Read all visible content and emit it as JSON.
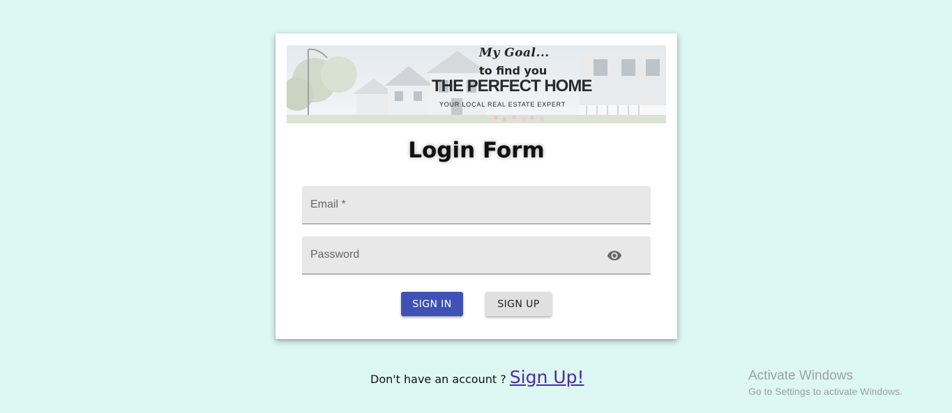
{
  "banner": {
    "line1": "My Goal...",
    "line2": "to find you",
    "line3": "THE PERFECT HOME",
    "line4": "YOUR LOCAL REAL ESTATE EXPERT"
  },
  "form": {
    "title": "Login Form",
    "email_placeholder": "Email *",
    "password_placeholder": "Password",
    "signin_label": "SIGN IN",
    "signup_label": "SIGN UP"
  },
  "footer": {
    "prompt": "Don't have an account ? ",
    "link": "Sign Up!"
  },
  "watermark": {
    "title": "Activate Windows",
    "subtitle": "Go to Settings to activate Windows."
  },
  "colors": {
    "background": "#ddf7f2",
    "primary": "#3f51b5",
    "secondary_button": "#e0e0e0",
    "link": "#4b2aa8"
  },
  "icons": {
    "password_toggle": "eye-icon"
  }
}
